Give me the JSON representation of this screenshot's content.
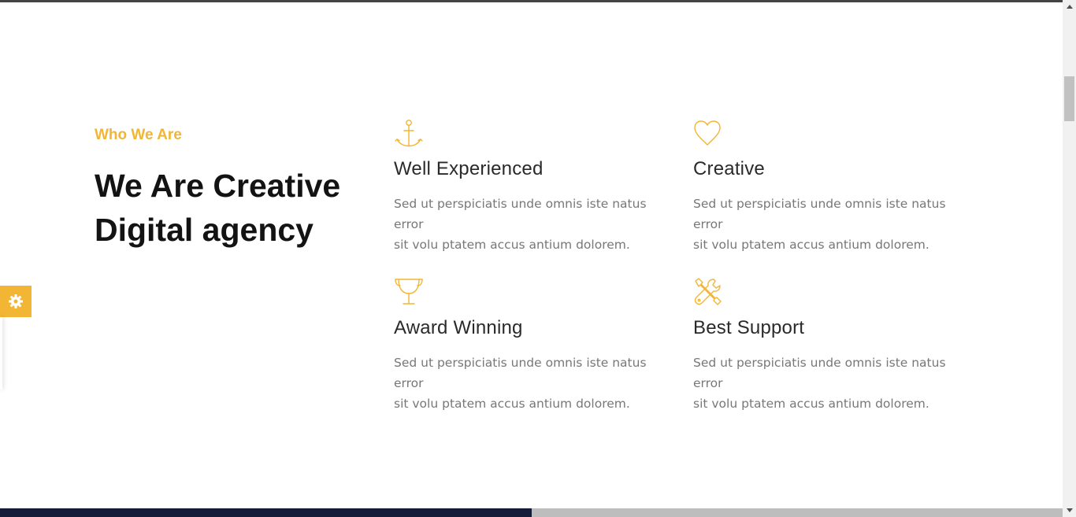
{
  "intro": {
    "eyebrow": "Who We Are",
    "headline_line1": "We Are Creative",
    "headline_line2": "Digital agency"
  },
  "features": [
    {
      "icon": "anchor-icon",
      "title": "Well Experienced",
      "desc_line1": "Sed ut perspiciatis unde omnis iste natus error",
      "desc_line2": "sit volu ptatem accus antium dolorem."
    },
    {
      "icon": "heart-icon",
      "title": "Creative",
      "desc_line1": "Sed ut perspiciatis unde omnis iste natus error",
      "desc_line2": "sit volu ptatem accus antium dolorem."
    },
    {
      "icon": "trophy-icon",
      "title": "Award Winning",
      "desc_line1": "Sed ut perspiciatis unde omnis iste natus error",
      "desc_line2": "sit volu ptatem accus antium dolorem."
    },
    {
      "icon": "tools-icon",
      "title": "Best Support",
      "desc_line1": "Sed ut perspiciatis unde omnis iste natus error",
      "desc_line2": "sit volu ptatem accus antium dolorem."
    }
  ],
  "settings": {
    "icon": "gear-icon"
  },
  "colors": {
    "accent": "#f2b534",
    "heading": "#131313",
    "body_text": "#777777",
    "footer_dark": "#141c3a"
  }
}
